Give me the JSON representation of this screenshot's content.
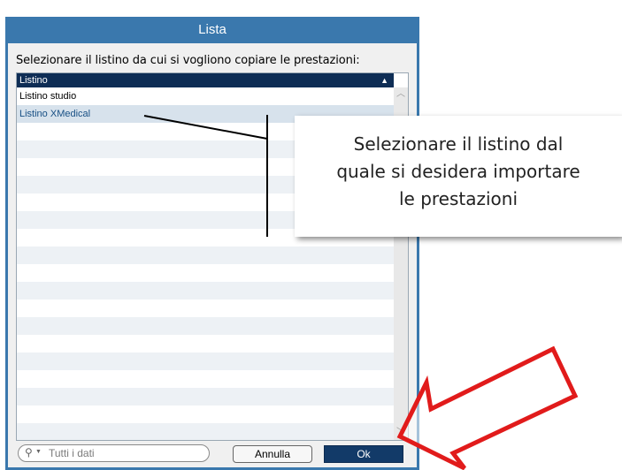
{
  "window": {
    "title": "Lista"
  },
  "instruction": "Selezionare il listino da cui si vogliono copiare le prestazioni:",
  "grid": {
    "column_header": "Listino",
    "sort_indicator": "▲",
    "rows": [
      "Listino studio",
      "Listino XMedical"
    ],
    "selected_row": 1
  },
  "search": {
    "icon": "search-icon",
    "placeholder": "Tutti i dati"
  },
  "buttons": {
    "cancel": "Annulla",
    "ok": "Ok"
  },
  "callout": {
    "lines": [
      "Selezionare il listino dal",
      "quale si desidera importare",
      "le prestazioni"
    ]
  },
  "colors": {
    "title_bar": "#3a78ad",
    "header": "#0e2d55",
    "selected_row": "#d7e2ec",
    "ok_button": "#123a68",
    "arrow": "#e11b1b"
  }
}
